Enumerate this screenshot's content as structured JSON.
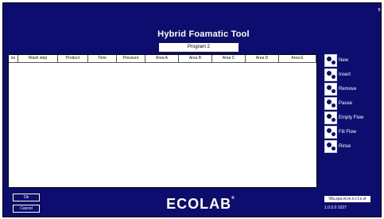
{
  "app": {
    "title": "Hybrid Foamatic Tool",
    "close_label": "x"
  },
  "program": {
    "value": "Program 2"
  },
  "table": {
    "columns": [
      "no",
      "Wash step",
      "Product",
      "Time",
      "Pressure",
      "Area A",
      "Area B",
      "Area C",
      "Area D",
      "Area E"
    ],
    "rows": []
  },
  "side_buttons": [
    {
      "label": "New",
      "icon": "gears-icon"
    },
    {
      "label": "Insert",
      "icon": "gears-icon"
    },
    {
      "label": "Remove",
      "icon": "gears-icon"
    },
    {
      "label": "Pause",
      "icon": "gears-icon"
    },
    {
      "label": "Empty Flow",
      "icon": "gears-icon"
    },
    {
      "label": "Fill Flow",
      "icon": "gears-icon"
    },
    {
      "label": "Rinse",
      "icon": "gears-icon"
    }
  ],
  "bottom_buttons": {
    "ok": "Ok",
    "cancel": "Cancel"
  },
  "logo": {
    "text": "ECOLAB",
    "mark": "®"
  },
  "footer": {
    "info": "Wa.spa.nt.m.n.r.f.e.st",
    "version": "1.0.0.0 1027"
  },
  "colors": {
    "background": "#0c0d6e",
    "table": "#ffffff",
    "text": "#ffffff"
  }
}
